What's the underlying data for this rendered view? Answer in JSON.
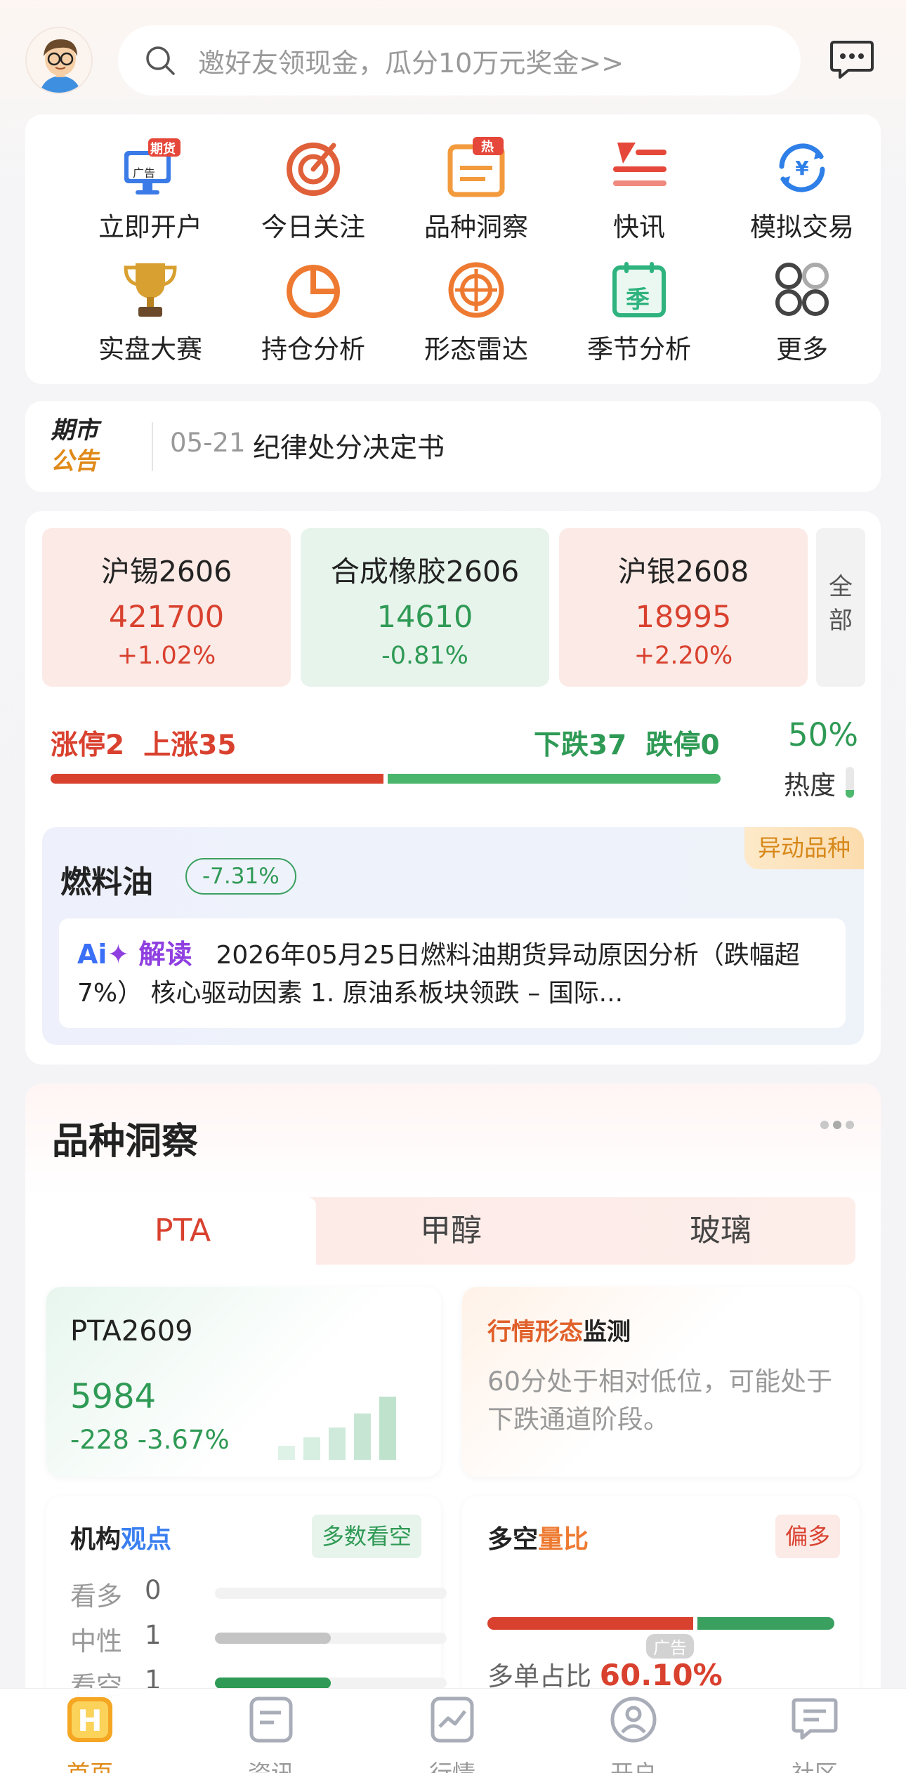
{
  "search": {
    "placeholder": "邀好友领现金，瓜分10万元奖金>>"
  },
  "grid": {
    "row1": [
      {
        "label": "立即开户",
        "badge": "期货",
        "sub": "广告"
      },
      {
        "label": "今日关注"
      },
      {
        "label": "品种洞察",
        "badge": "热"
      },
      {
        "label": "快讯"
      },
      {
        "label": "模拟交易"
      }
    ],
    "row2": [
      {
        "label": "实盘大赛"
      },
      {
        "label": "持仓分析"
      },
      {
        "label": "形态雷达"
      },
      {
        "label": "季节分析",
        "icon_char": "季"
      },
      {
        "label": "更多"
      }
    ]
  },
  "notice": {
    "logo_top": "期市",
    "logo_bottom": "公告",
    "date": "05-21",
    "title": "纪律处分决定书"
  },
  "quotes": [
    {
      "name": "沪锡2606",
      "price": "421700",
      "change": "+1.02%",
      "dir": "up"
    },
    {
      "name": "合成橡胶2606",
      "price": "14610",
      "change": "-0.81%",
      "dir": "down"
    },
    {
      "name": "沪银2608",
      "price": "18995",
      "change": "+2.20%",
      "dir": "up"
    }
  ],
  "all_button": {
    "line1": "全",
    "line2": "部"
  },
  "breadth": {
    "limit_up": "涨停2",
    "up": "上涨35",
    "down": "下跌37",
    "limit_down": "跌停0",
    "up_fraction": 0.5,
    "heat_pct": "50%",
    "heat_label": "热度",
    "heat_fraction": 0.5
  },
  "anomaly": {
    "tag": "异动品种",
    "name": "燃料油",
    "change": "-7.31%",
    "ai_a": "Ai",
    "ai_t": "解读",
    "text": "2026年05月25日燃料油期货异动原因分析（跌幅超7%）   核心驱动因素   1. 原油系板块领跌   – 国际..."
  },
  "insight": {
    "title": "品种洞察",
    "tabs": [
      "PTA",
      "甲醇",
      "玻璃"
    ],
    "contract": {
      "code": "PTA2609",
      "price": "5984",
      "change": "-228 -3.67%"
    },
    "pattern": {
      "title_a": "行情形态",
      "title_b": "监测",
      "text": "60分处于相对低位，可能处于下跌通道阶段。"
    },
    "views": {
      "title_a": "机构",
      "title_b": "观点",
      "badge": "多数看空",
      "rows": [
        {
          "label": "看多",
          "count": "0",
          "fraction": 0
        },
        {
          "label": "中性",
          "count": "1",
          "fraction": 0.5
        },
        {
          "label": "看空",
          "count": "1",
          "fraction": 0.5
        }
      ]
    },
    "ratio": {
      "title_a": "多空",
      "title_b": "量比",
      "badge": "偏多",
      "long_fraction": 0.601,
      "line_label": "多单占比",
      "line_value": "60.10%",
      "ad": "广告"
    }
  },
  "nav": [
    {
      "label": "首页",
      "active": true
    },
    {
      "label": "资讯"
    },
    {
      "label": "行情"
    },
    {
      "label": "开户"
    },
    {
      "label": "社区"
    }
  ],
  "colors": {
    "up": "#d9412f",
    "down": "#2f9a55",
    "accent": "#e08a1a"
  }
}
